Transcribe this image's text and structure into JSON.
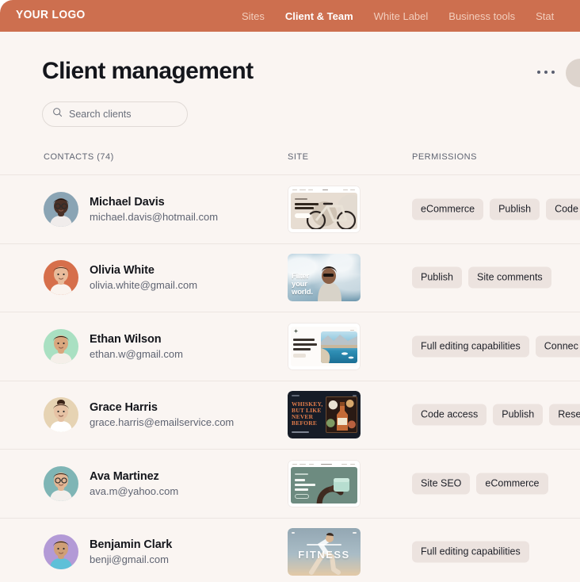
{
  "brand": {
    "logo_text": "YOUR LOGO",
    "header_color": "#cd6f4f",
    "page_bg": "#faf5f2",
    "tag_bg": "#ece3df"
  },
  "nav": {
    "items": [
      {
        "label": "Sites",
        "active": false
      },
      {
        "label": "Client & Team",
        "active": true
      },
      {
        "label": "White Label",
        "active": false
      },
      {
        "label": "Business tools",
        "active": false
      },
      {
        "label": "Stat",
        "active": false
      }
    ]
  },
  "header": {
    "title": "Client management",
    "more_icon": "kebab-menu-icon",
    "avatar_icon": "user-avatar"
  },
  "search": {
    "placeholder": "Search clients",
    "value": "",
    "icon": "search-icon"
  },
  "table": {
    "columns": {
      "contacts": "CONTACTS (74)",
      "site": "SITE",
      "permissions": "PERMISSIONS"
    },
    "rows": [
      {
        "name": "Michael Davis",
        "email": "michael.davis@hotmail.com",
        "avatar_bg": "#8aa4b4",
        "site": "bike-shop-site",
        "permissions": [
          "eCommerce",
          "Publish",
          "Code a"
        ]
      },
      {
        "name": "Olivia White",
        "email": "olivia.white@gmail.com",
        "avatar_bg": "#d66f4b",
        "site": "filter-your-world-site",
        "permissions": [
          "Publish",
          "Site comments"
        ]
      },
      {
        "name": "Ethan Wilson",
        "email": "ethan.w@gmail.com",
        "avatar_bg": "#a9e0c2",
        "site": "magical-getaway-travel-site",
        "permissions": [
          "Full editing capabilities",
          "Connec"
        ]
      },
      {
        "name": "Grace Harris",
        "email": "grace.harris@emailservice.com",
        "avatar_bg": "#e6d3b3",
        "site": "whiskey-brand-site",
        "permissions": [
          "Code access",
          "Publish",
          "Reset sit"
        ]
      },
      {
        "name": "Ava Martinez",
        "email": "ava.m@yahoo.com",
        "avatar_bg": "#7fb5b5",
        "site": "soap-product-site",
        "permissions": [
          "Site SEO",
          "eCommerce"
        ]
      },
      {
        "name": "Benjamin Clark",
        "email": "benji@gmail.com",
        "avatar_bg": "#b39ad6",
        "site": "fitness-site",
        "permissions": [
          "Full editing capabilities"
        ]
      }
    ]
  },
  "thumbnails": {
    "bike": {
      "headline": "We're going to buy that bike",
      "cta": "SHOP NOW"
    },
    "filter": {
      "headline_lines": [
        "Filter",
        "your",
        "world."
      ]
    },
    "travel": {
      "headline_lines": [
        "Plan Your",
        "Next Magical",
        "Getaway"
      ],
      "cta": "EXPLORE"
    },
    "whiskey": {
      "headline_lines": [
        "WHISKEY,",
        "BUT LIKE",
        "NEVER",
        "BEFORE"
      ],
      "cta": "DISCOVER MORE"
    },
    "soap": {
      "headline_lines": [
        "Best",
        "promotion",
        "soap"
      ],
      "cta": "SHOP NOW"
    },
    "fitness": {
      "headline": "FITNESS"
    }
  }
}
